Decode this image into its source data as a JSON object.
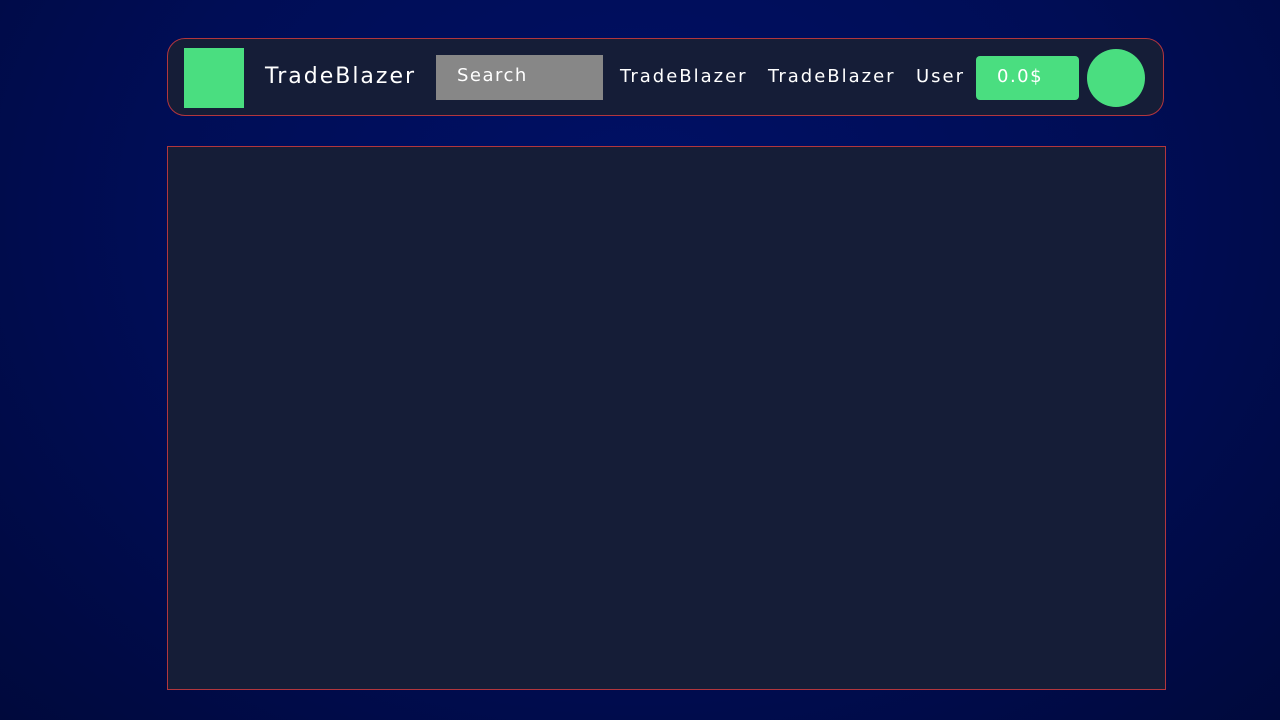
{
  "navbar": {
    "brand": "TradeBlazer",
    "search_label": "Search",
    "links": [
      "TradeBlazer",
      "TradeBlazer",
      "User"
    ],
    "balance": "0.0$"
  },
  "colors": {
    "accent": "#4ade80",
    "background": "#000d55",
    "panel": "#151d37",
    "border": "#b2363d",
    "search_bg": "#878787"
  }
}
